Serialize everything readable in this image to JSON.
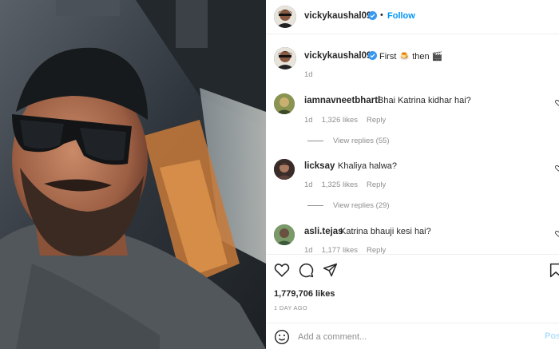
{
  "post": {
    "username": "vickykaushal09",
    "follow_label": "Follow",
    "separator": "•",
    "more_label": "...",
    "photo_alt": "Man in sunglasses and cap sitting in car"
  },
  "caption": {
    "username": "vickykaushal09",
    "text": "First 🍮 then 🎬",
    "time": "1d"
  },
  "comments": [
    {
      "username": "iamnavneetbharti",
      "text": "Bhai Katrina kidhar hai?",
      "time": "1d",
      "likes": "1,326 likes",
      "reply_label": "Reply",
      "view_replies": "View replies (55)",
      "avatar_color": "#6b7a3a"
    },
    {
      "username": "licksay",
      "text": "Khaliya halwa?",
      "time": "1d",
      "likes": "1,325 likes",
      "reply_label": "Reply",
      "view_replies": "View replies (29)",
      "avatar_color": "#4a3a36"
    },
    {
      "username": "asli.tejas",
      "text": "Katrina bhauji kesi hai?",
      "time": "1d",
      "likes": "1,177 likes",
      "reply_label": "Reply",
      "view_replies": "",
      "avatar_color": "#5d7a4a"
    }
  ],
  "actions": {
    "likes": "1,779,706 likes",
    "ago": "1 DAY AGO",
    "comment_placeholder": "Add a comment...",
    "post_label": "Post"
  },
  "colors": {
    "link_blue": "#0095f6",
    "verified_blue": "#3897f0",
    "muted": "#8e8e8e"
  }
}
